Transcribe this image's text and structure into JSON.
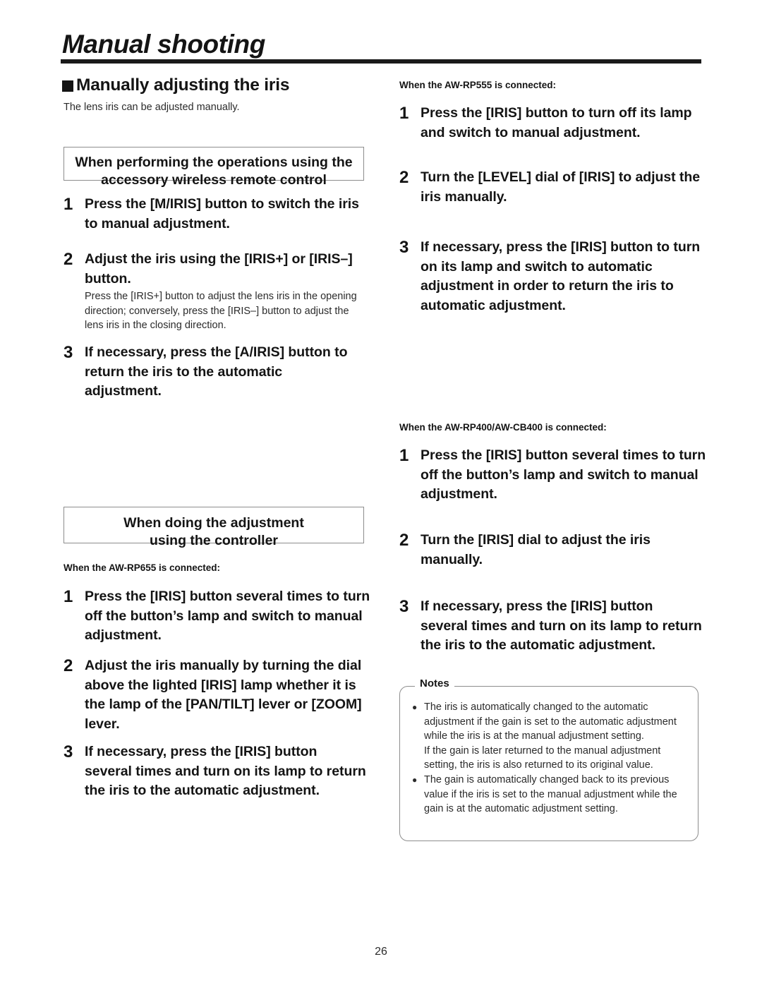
{
  "document": {
    "chapter_title": "Manual shooting",
    "page_number": "26"
  },
  "section": {
    "heading": "Manually adjusting the iris",
    "intro": "The lens iris can be adjusted manually."
  },
  "left_column": {
    "head_box_remote": {
      "line1": "When performing the operations using the",
      "line2": "accessory wireless remote control"
    },
    "remote_steps": [
      {
        "num": "1",
        "text": "Press the [M/IRIS] button to switch the iris to manual adjustment."
      },
      {
        "num": "2",
        "text": "Adjust the iris using the [IRIS+] or [IRIS–] button."
      },
      {
        "num": "3",
        "text": "If necessary, press the [A/IRIS] button to return the iris to the automatic adjustment."
      }
    ],
    "remote_step2_note": "Press the [IRIS+] button to adjust the lens iris in the opening direction; conversely, press the [IRIS–] button to adjust the lens iris in the closing direction.",
    "head_box_controller": {
      "line1": "When doing the adjustment",
      "line2": "using the controller"
    },
    "rp655_label": "When the AW-RP655 is connected:",
    "rp655_steps": [
      {
        "num": "1",
        "text": "Press the [IRIS] button several times to turn off the button’s lamp and switch to manual adjustment."
      },
      {
        "num": "2",
        "text": "Adjust the iris manually by turning the dial above the lighted [IRIS] lamp whether it is the lamp of the [PAN/TILT] lever or [ZOOM] lever."
      },
      {
        "num": "3",
        "text": "If necessary, press the [IRIS] button several times and turn on its lamp to return the iris to the automatic adjustment."
      }
    ]
  },
  "right_column": {
    "rp555_label": "When the AW-RP555 is connected:",
    "rp555_steps": [
      {
        "num": "1",
        "text": "Press the [IRIS] button to turn off its lamp and switch to manual adjustment."
      },
      {
        "num": "2",
        "text": "Turn the [LEVEL] dial of [IRIS] to adjust the iris manually."
      },
      {
        "num": "3",
        "text": "If necessary, press the [IRIS] button to turn on its lamp and switch to automatic adjustment in order to return the iris to automatic adjustment."
      }
    ],
    "rp400_label": "When the AW-RP400/AW-CB400 is connected:",
    "rp400_steps": [
      {
        "num": "1",
        "text": "Press the [IRIS] button several times to turn off the button’s lamp and switch to manual adjustment."
      },
      {
        "num": "2",
        "text": "Turn the [IRIS] dial to adjust the iris manually."
      },
      {
        "num": "3",
        "text": "If necessary, press the [IRIS] button several times and turn on its lamp to return the iris to the automatic adjustment."
      }
    ],
    "notes": {
      "title": "Notes",
      "bullet_glyph": "●",
      "items": [
        "The iris is automatically changed to the automatic adjustment if the gain is set to the automatic adjustment while the iris is at the manual adjustment setting.",
        "The gain is automatically changed back to its previous value if the iris is set to the manual adjustment while the gain is at the automatic adjustment setting."
      ],
      "sub_note": "If the gain is later returned to the manual adjustment setting, the iris is also returned to its original value."
    }
  }
}
